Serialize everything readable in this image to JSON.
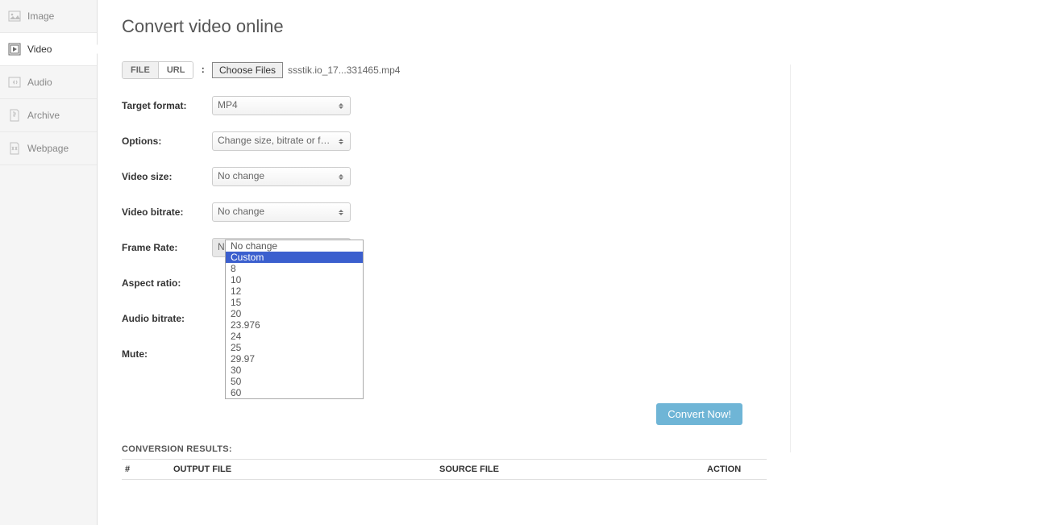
{
  "sidebar": {
    "items": [
      {
        "label": "Image",
        "icon": "image-icon"
      },
      {
        "label": "Video",
        "icon": "video-icon"
      },
      {
        "label": "Audio",
        "icon": "audio-icon"
      },
      {
        "label": "Archive",
        "icon": "archive-icon"
      },
      {
        "label": "Webpage",
        "icon": "webpage-icon"
      }
    ]
  },
  "page": {
    "title": "Convert video online"
  },
  "form": {
    "source_tabs": {
      "file": "FILE",
      "url": "URL",
      "colon": ":"
    },
    "choose_files": "Choose Files",
    "filename": "ssstik.io_17...331465.mp4",
    "labels": {
      "target_format": "Target format:",
      "options": "Options:",
      "video_size": "Video size:",
      "video_bitrate": "Video bitrate:",
      "frame_rate": "Frame Rate:",
      "aspect_ratio": "Aspect ratio:",
      "audio_bitrate": "Audio bitrate:",
      "mute": "Mute:"
    },
    "selects": {
      "target_format": "MP4",
      "options": "Change size, bitrate or frame rate",
      "video_size": "No change",
      "video_bitrate": "No change",
      "frame_rate": "No change"
    },
    "frame_rate_options": [
      "No change",
      "Custom",
      "8",
      "10",
      "12",
      "15",
      "20",
      "23.976",
      "24",
      "25",
      "29.97",
      "30",
      "50",
      "60"
    ],
    "frame_rate_highlighted_index": 1,
    "convert_button": "Convert Now!"
  },
  "results": {
    "title": "CONVERSION RESULTS:",
    "headers": {
      "idx": "#",
      "output": "OUTPUT FILE",
      "source": "SOURCE FILE",
      "action": "ACTION"
    }
  }
}
